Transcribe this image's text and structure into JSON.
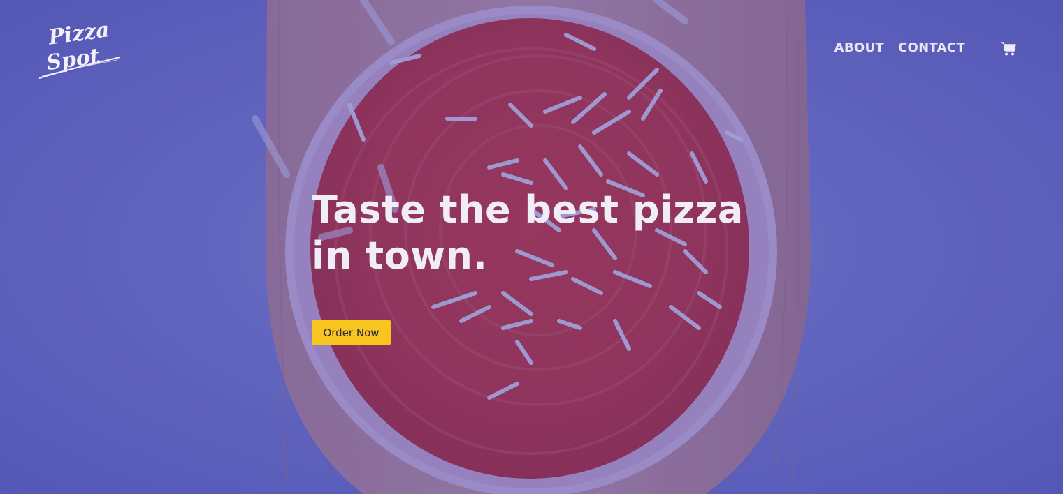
{
  "brand": {
    "logo_line1": "Pizza",
    "logo_line2": "Spot"
  },
  "nav": {
    "items": [
      {
        "label": "ABOUT"
      },
      {
        "label": "CONTACT"
      }
    ],
    "cart_icon": "shopping-cart-icon"
  },
  "hero": {
    "headline_line1": "Taste the best pizza",
    "headline_line2": "in town.",
    "cta_label": "Order Now"
  },
  "colors": {
    "overlay": "#5b5fae",
    "cta_background": "#f7c51e",
    "text": "#f1edf7"
  }
}
